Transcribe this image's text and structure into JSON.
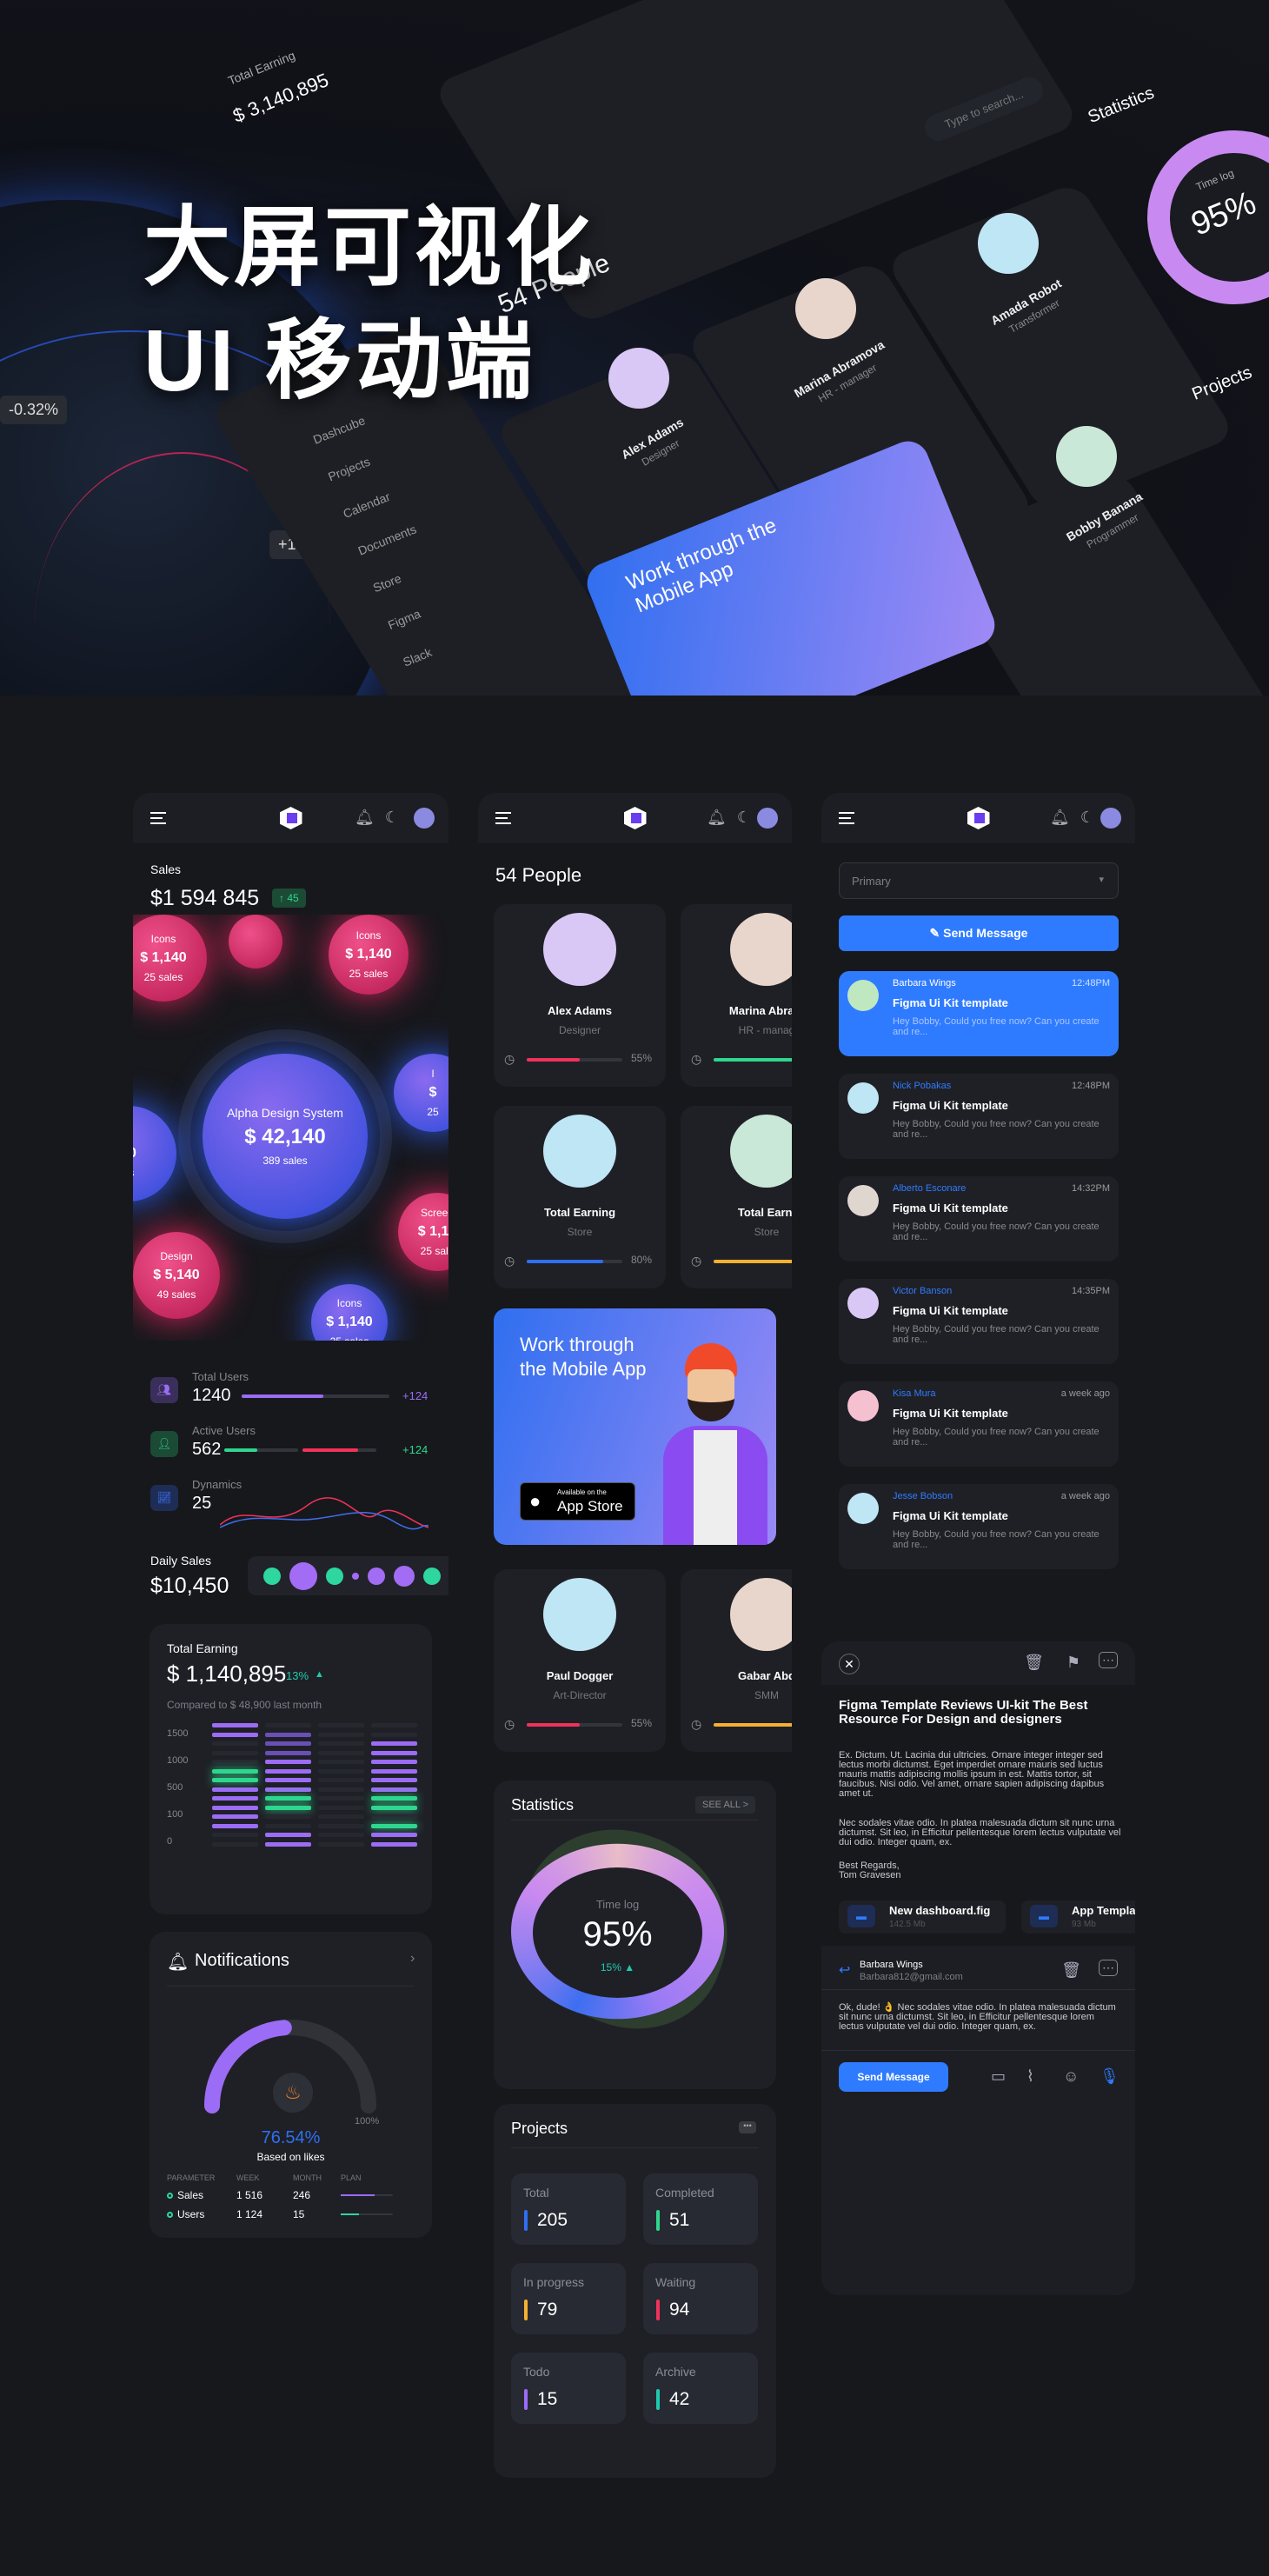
{
  "hero": {
    "title_line1": "大屏可视化",
    "title_line2": "UI 移动端",
    "labels": {
      "earning_title": "Total Earning",
      "earning_value": "$ 3,140,895",
      "people": "54 People",
      "statistics": "Statistics",
      "projects": "Projects",
      "time_log": "Time log",
      "percent": "95%",
      "banner": "Work through the Mobile App",
      "delta1": "-0.32%",
      "delta2": "+1.42%",
      "search": "Type to search...",
      "nav": [
        "Dashcube",
        "Projects",
        "Calendar",
        "Documents",
        "Store",
        "Figma",
        "Slack"
      ],
      "people_cards": [
        {
          "name": "Alex Adams",
          "role": "Designer"
        },
        {
          "name": "Marina Abramova",
          "role": "HR - manager"
        },
        {
          "name": "Amada Robot",
          "role": "Transformer"
        },
        {
          "name": "Bobby Banana",
          "role": "Programmer"
        }
      ]
    }
  },
  "dashboard": {
    "sales_label": "Sales",
    "sales_value": "$1 594 845",
    "sales_badge": "↑ 45",
    "bubbles": [
      {
        "title": "Icons",
        "value": "$ 1,140",
        "sub": "25 sales",
        "color": "pink"
      },
      {
        "title": "",
        "value": "",
        "sub": "",
        "color": "pink"
      },
      {
        "title": "Icons",
        "value": "$ 1,140",
        "sub": "25 sales",
        "color": "pink"
      },
      {
        "title": "Alpha Design System",
        "value": "$ 42,140",
        "sub": "389 sales",
        "color": "blue"
      },
      {
        "title": "s",
        "value": "40",
        "sub": "es",
        "color": "blue"
      },
      {
        "title": "I",
        "value": "$",
        "sub": "25",
        "color": "blue"
      },
      {
        "title": "Design",
        "value": "$ 5,140",
        "sub": "49 sales",
        "color": "pink"
      },
      {
        "title": "Icons",
        "value": "$ 1,140",
        "sub": "25 sales",
        "color": "blue"
      },
      {
        "title": "Screen",
        "value": "$ 1,14",
        "sub": "25 sale",
        "color": "pink"
      }
    ],
    "metrics": [
      {
        "label": "Total Users",
        "value": "1240",
        "delta": "+124",
        "progress": 0.55,
        "color": "#9b6cf5"
      },
      {
        "label": "Active Users",
        "value": "562",
        "delta": "+124",
        "progress": 0.45,
        "color": "#2ed68e"
      },
      {
        "label": "Dynamics",
        "value": "25",
        "delta": "",
        "progress": 0,
        "color": "#3d6ff0"
      }
    ],
    "daily_label": "Daily Sales",
    "daily_value": "$10,450",
    "earning": {
      "title": "Total Earning",
      "value": "$ 1,140,895",
      "pct": "13%",
      "compare": "Compared to $ 48,900 last month",
      "yticks": [
        "1500",
        "1000",
        "500",
        "100",
        "0"
      ],
      "columns": [
        "PPdddGGPPPPPdd",
        "dqqqPPPPGGddPP",
        "dddddddddddddd",
        "ddPPPPPPGGdGPP"
      ]
    },
    "notifications": {
      "title": "Notifications",
      "gauge_value": "76.54%",
      "gauge_fraction": 0.7654,
      "gauge_caption": "Based on likes",
      "gauge_max": "100%",
      "headers": [
        "PARAMETER",
        "WEEK",
        "MONTH",
        "PLAN"
      ],
      "rows": [
        {
          "name": "Sales",
          "week": "1 516",
          "month": "246",
          "plan": 0.65,
          "color": "#9b6cf5"
        },
        {
          "name": "Users",
          "week": "1 124",
          "month": "15",
          "plan": 0.35,
          "color": "#2ed6a0"
        }
      ]
    }
  },
  "people": {
    "title": "54 People",
    "cards": [
      {
        "name": "Alex Adams",
        "role": "Designer",
        "pct": "55%",
        "progress": 0.55,
        "color": "#f0325a",
        "bg": "#d9c8f5"
      },
      {
        "name": "Marina Abram",
        "role": "HR - manag",
        "pct": "",
        "progress": 0.85,
        "color": "#2ed68e",
        "bg": "#e8d6cc"
      },
      {
        "name": "Total Earning",
        "role": "Store",
        "pct": "80%",
        "progress": 0.8,
        "color": "#2f6ff0",
        "bg": "#bfe6f5"
      },
      {
        "name": "Total Earni",
        "role": "Store",
        "pct": "",
        "progress": 0.85,
        "color": "#f5b030",
        "bg": "#c9e8d8"
      },
      {
        "name": "Paul Dogger",
        "role": "Art-Director",
        "pct": "55%",
        "progress": 0.55,
        "color": "#f0325a",
        "bg": "#bfe6f5"
      },
      {
        "name": "Gabar Abd",
        "role": "SMM",
        "pct": "",
        "progress": 0.85,
        "color": "#f5b030",
        "bg": "#e8d6cc"
      }
    ],
    "banner": {
      "line1": "Work through",
      "line2": "the Mobile App",
      "store_small": "Available on the",
      "store_big": "App Store"
    },
    "statistics": {
      "title": "Statistics",
      "see_all": "SEE ALL >",
      "label": "Time log",
      "value": "95%",
      "delta": "15% ▲"
    },
    "projects": {
      "title": "Projects",
      "items": [
        {
          "label": "Total",
          "value": "205",
          "color": "#2f6ff0"
        },
        {
          "label": "Completed",
          "value": "51",
          "color": "#2ed68e"
        },
        {
          "label": "In progress",
          "value": "79",
          "color": "#f5b030"
        },
        {
          "label": "Waiting",
          "value": "94",
          "color": "#f0325a"
        },
        {
          "label": "Todo",
          "value": "15",
          "color": "#9b6cf5"
        },
        {
          "label": "Archive",
          "value": "42",
          "color": "#1fc9b0"
        }
      ]
    }
  },
  "inbox": {
    "select_value": "Primary",
    "send_label": "Send Message",
    "messages": [
      {
        "sender": "Barbara Wings",
        "time": "12:48PM",
        "subject": "Figma Ui Kit template",
        "preview": "Hey Bobby, Could you free now? Can you create and re...",
        "active": true,
        "bg": "#bfe8c0"
      },
      {
        "sender": "Nick Pobakas",
        "time": "12:48PM",
        "subject": "Figma Ui Kit template",
        "preview": "Hey Bobby, Could you free now? Can you create and re...",
        "active": false,
        "bg": "#bfe6f5"
      },
      {
        "sender": "Alberto Esconare",
        "time": "14:32PM",
        "subject": "Figma Ui Kit template",
        "preview": "Hey Bobby, Could you free now? Can you create and re...",
        "active": false,
        "bg": "#e0d6d0"
      },
      {
        "sender": "Victor Banson",
        "time": "14:35PM",
        "subject": "Figma Ui Kit template",
        "preview": "Hey Bobby, Could you free now? Can you create and re...",
        "active": false,
        "bg": "#d9c8f5"
      },
      {
        "sender": "Kisa Mura",
        "time": "a week ago",
        "subject": "Figma Ui Kit template",
        "preview": "Hey Bobby, Could you free now? Can you create and re...",
        "active": false,
        "bg": "#f5c0d0"
      },
      {
        "sender": "Jesse Bobson",
        "time": "a week ago",
        "subject": "Figma Ui Kit template",
        "preview": "Hey Bobby, Could you free now? Can you create and re...",
        "active": false,
        "bg": "#bfe6f5"
      }
    ]
  },
  "email": {
    "title": "Figma Template Reviews UI-kit The Best Resource For Design and  designers",
    "para1": "Ex. Dictum. Ut. Lacinia dui ultricies. Ornare integer  integer sed lectus morbi dictumst. Eget imperdiet ornare mauris sed luctus mauris mattis adipiscing mollis ipsum in est. Mattis tortor, sit faucibus. Nisi odio. Vel amet, ornare sapien adipiscing dapibus amet ut.",
    "para2": "Nec sodales vitae odio. In platea malesuada dictum sit nunc urna dictumst. Sit leo, in Efficitur pellentesque lorem lectus vulputate vel dui odio. Integer quam, ex.",
    "sign1": "Best Regards,",
    "sign2": "Tom Gravesen",
    "attachments": [
      {
        "name": "New dashboard.fig",
        "size": "142.5 Mb"
      },
      {
        "name": "App Templa",
        "size": "93 Mb"
      }
    ],
    "reply_name": "Barbara Wings",
    "reply_email": "Barbara812@gmail.com",
    "reply_text": "Ok, dude! 👌 Nec sodales vitae odio. In platea malesuada dictum sit nunc urna dictumst. Sit leo, in Efficitur pellentesque lorem lectus vulputate vel dui odio. Integer quam, ex.",
    "send_label": "Send Message"
  },
  "colors": {
    "accent": "#2f7bff",
    "purple": "#9b6cf5",
    "green": "#2ed68e",
    "red": "#f0325a",
    "bg": "#17181c",
    "card": "#1f2026"
  }
}
